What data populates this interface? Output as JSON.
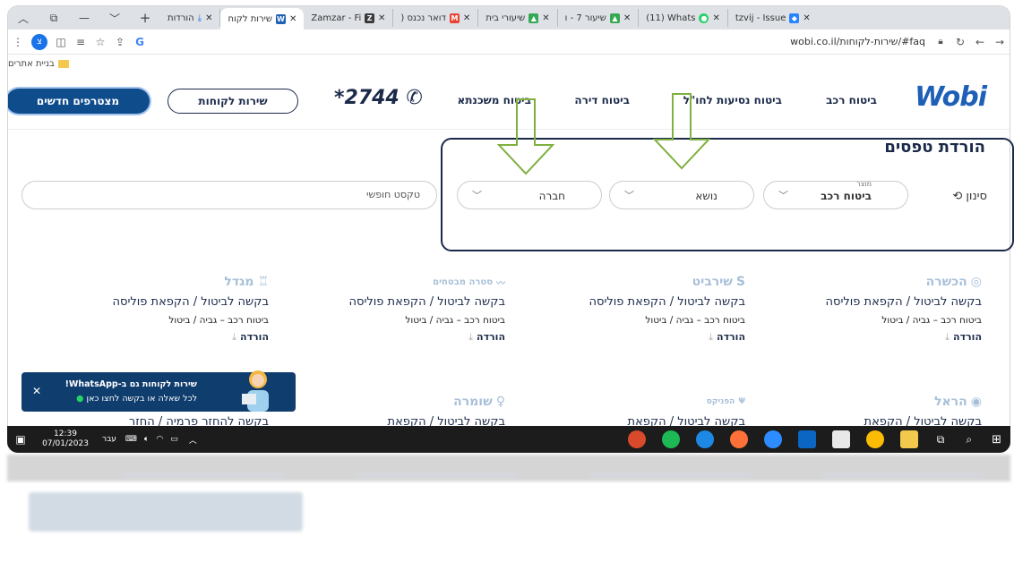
{
  "browser": {
    "tabs": [
      {
        "label": "הורדות",
        "icon": "download-icon"
      },
      {
        "label": "שירות לקוח",
        "icon": "wobi-icon",
        "active": true
      },
      {
        "label": "Zamzar - Fi",
        "icon": "zamzar-icon"
      },
      {
        "label": "דואר נכנס (",
        "icon": "gmail-icon"
      },
      {
        "label": "שיעורי בית",
        "icon": "drive-icon"
      },
      {
        "label": "שיעור 7 - ו",
        "icon": "drive-icon"
      },
      {
        "label": "(11) Whats",
        "icon": "whatsapp-icon"
      },
      {
        "label": "tzvij - Issue",
        "icon": "jira-icon"
      }
    ],
    "profile_letter": "צ",
    "url": "wobi.co.il/שירות-לקוחות/#faq",
    "bookmark_label": "בניית אתרים"
  },
  "site": {
    "logo": "Wobi",
    "nav": [
      "ביטוח רכב",
      "ביטוח נסיעות לחו\"ל",
      "ביטוח דירה",
      "ביטוח משכנתא"
    ],
    "phone": "*2744",
    "customer_service_button": "שירות לקוחות",
    "join_button": "מצטרפים חדשים"
  },
  "filters": {
    "title": "הורדת טפסים",
    "filter_label": "סינון",
    "product_caption": "מוצר",
    "product_value": "ביטוח רכב",
    "topic_placeholder": "נושא",
    "company_placeholder": "חברה",
    "free_text_placeholder": "טקסט חופשי"
  },
  "cards": [
    {
      "brand": "הכשרה",
      "title": "בקשה לביטול / הקפאת פוליסה",
      "sub": "ביטוח רכב – גביה / ביטול",
      "download": "הורדה"
    },
    {
      "brand": "שירביט",
      "title": "בקשה לביטול / הקפאת פוליסה",
      "sub": "ביטוח רכב – גביה / ביטול",
      "download": "הורדה"
    },
    {
      "brand": "סטרה מבטחים",
      "title": "בקשה לביטול / הקפאת פוליסה",
      "sub": "ביטוח רכב – גביה / ביטול",
      "download": "הורדה"
    },
    {
      "brand": "מגדל",
      "title": "בקשה לביטול / הקפאת פוליסה",
      "sub": "ביטוח רכב – גביה / ביטול",
      "download": "הורדה"
    },
    {
      "brand": "הראל",
      "title": "בקשה לביטול / הקפאת",
      "sub": "",
      "download": ""
    },
    {
      "brand": "הפניקס",
      "title": "בקשה לביטול / הקפאת",
      "sub": "",
      "download": ""
    },
    {
      "brand": "שומרה",
      "title": "בקשה לביטול / הקפאת",
      "sub": "",
      "download": ""
    },
    {
      "brand": "",
      "title": "בקשה להחזר פרמיה / החזר",
      "sub": "",
      "download": ""
    }
  ],
  "whatsapp": {
    "line1": "שירות לקוחות גם ב-WhatsApp!",
    "line2": "לכל שאלה או בקשה לחצו כאן"
  },
  "taskbar": {
    "time": "12:39",
    "date": "07/01/2023",
    "lang": "עבר"
  },
  "colors": {
    "brand_blue": "#1e5fb8",
    "navy": "#1b2a4a",
    "arrow_green": "#7fb040"
  }
}
